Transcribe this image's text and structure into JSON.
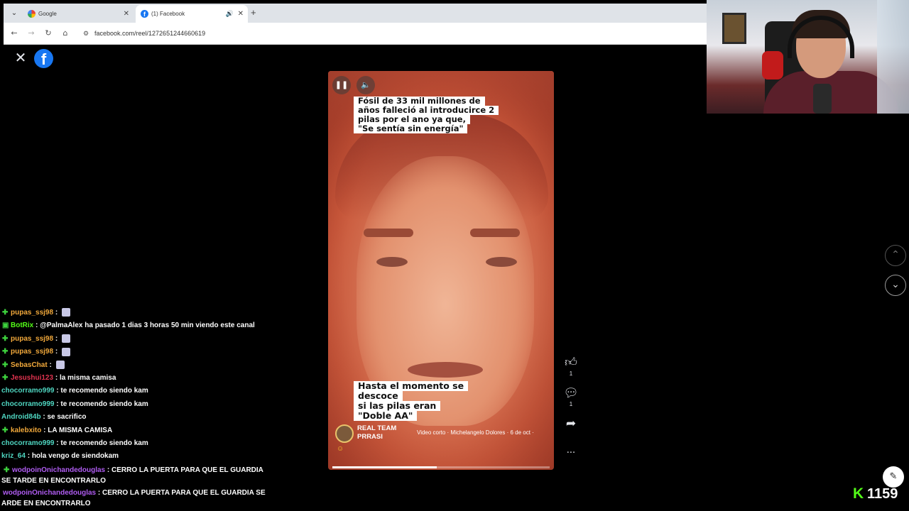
{
  "browser": {
    "tabs": [
      {
        "title": "Google",
        "close": "✕"
      },
      {
        "title": "(1) Facebook",
        "close": "✕",
        "audio": "🔊"
      }
    ],
    "new_tab": "+",
    "url": "facebook.com/reel/1272651244660619"
  },
  "facebook": {
    "logo": "f",
    "close": "✕"
  },
  "reel": {
    "caption_top": [
      "Fósil de 33 mil millones de",
      "años falleció al introducirce 2",
      "pilas por el ano ya que,",
      "\"Se sentía sin energía\""
    ],
    "caption_bottom": [
      "Hasta el momento se",
      "descoce",
      "si las pilas eran",
      "\"Doble AA\""
    ],
    "author_name": "REAL TEAM PRRASI",
    "meta": "Video corto · Michelangelo Dolores · 6 de oct ·",
    "progress": 0.48
  },
  "actions": {
    "like_count": "1",
    "comment_count": "1"
  },
  "chat": [
    {
      "badge": "✚",
      "user": "pupas_ssj98",
      "color": "#f2a93b",
      "text": "",
      "emote": true
    },
    {
      "badge": "▣",
      "user": "BotRix",
      "color": "#53fc18",
      "text": "@PalmaAlex ha pasado 1 dias 3 horas 50 min viendo este canal",
      "emote": false
    },
    {
      "badge": "✚",
      "user": "pupas_ssj98",
      "color": "#f2a93b",
      "text": "",
      "emote": true
    },
    {
      "badge": "✚",
      "user": "pupas_ssj98",
      "color": "#f2a93b",
      "text": "",
      "emote": true
    },
    {
      "badge": "✚",
      "user": "SebasChat",
      "color": "#f2a93b",
      "text": "",
      "emote": true
    },
    {
      "badge": "✚",
      "user": "Jesushui123",
      "color": "#e0334f",
      "text": "la misma camisa",
      "emote": false
    },
    {
      "badge": "",
      "user": "chocorramo999",
      "color": "#4fd6c1",
      "text": "te recomendo siendo kam",
      "emote": false
    },
    {
      "badge": "",
      "user": "chocorramo999",
      "color": "#4fd6c1",
      "text": "te recomendo siendo kam",
      "emote": false
    },
    {
      "badge": "",
      "user": "Android84b",
      "color": "#4fd6c1",
      "text": "se sacrifico",
      "emote": false
    },
    {
      "badge": "✚",
      "user": "kalebxito",
      "color": "#f2a93b",
      "text": "LA MISMA CAMISA",
      "emote": false
    },
    {
      "badge": "",
      "user": "chocorramo999",
      "color": "#4fd6c1",
      "text": "te recomendo siendo kam",
      "emote": false
    },
    {
      "badge": "",
      "user": "kriz_64",
      "color": "#4fd6c1",
      "text": "hola vengo de siendokam",
      "emote": false
    },
    {
      "badge": "✚",
      "user": "wodpoinOnichandedouglas",
      "color": "#b05cf2",
      "text": "CERRO LA PUERTA PARA QUE EL GUARDIA SE TARDE EN ENCONTRARLO",
      "emote": false
    },
    {
      "badge": "",
      "user": "wodpoinOnichandedouglas",
      "color": "#b05cf2",
      "text": "CERRO LA PUERTA PARA QUE EL GUARDIA SE ARDE EN ENCONTRARLO",
      "emote": false
    }
  ],
  "viewer_count": "1159",
  "icons": {
    "menu": "chevron-down-icon",
    "back": "arrow-left-icon",
    "forward": "arrow-right-icon",
    "reload": "reload-icon",
    "home": "home-icon",
    "pause": "pause-icon",
    "volume": "volume-icon",
    "like": "thumbs-up-icon",
    "comment": "comment-icon",
    "share": "share-icon",
    "more": "more-icon",
    "up": "chevron-up-icon",
    "down": "chevron-down-icon",
    "edit": "edit-icon",
    "kick": "kick-logo-icon"
  }
}
